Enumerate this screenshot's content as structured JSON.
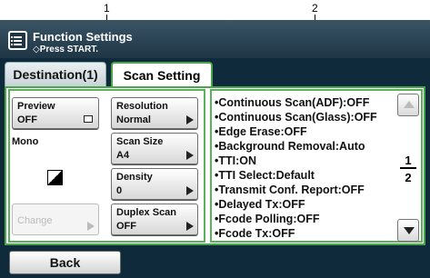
{
  "callouts": [
    "1",
    "2"
  ],
  "header": {
    "title": "Function Settings",
    "subtitle": "Press START."
  },
  "tabs": [
    {
      "label": "Destination(1)",
      "active": false
    },
    {
      "label": "Scan Setting",
      "active": true
    }
  ],
  "left_panel": {
    "preview": {
      "label": "Preview",
      "value": "OFF"
    },
    "mode_label": "Mono",
    "change_label": "Change"
  },
  "settings": [
    {
      "label": "Resolution",
      "value": "Normal"
    },
    {
      "label": "Scan Size",
      "value": "A4"
    },
    {
      "label": "Density",
      "value": "0"
    },
    {
      "label": "Duplex Scan",
      "value": "OFF"
    }
  ],
  "summary_list": [
    "•Continuous Scan(ADF):OFF",
    "•Continuous Scan(Glass):OFF",
    "•Edge Erase:OFF",
    "•Background Removal:Auto",
    "•TTI:ON",
    "•TTI Select:Default",
    "•Transmit Conf. Report:OFF",
    "•Delayed Tx:OFF",
    "•Fcode Polling:OFF",
    "•Fcode Tx:OFF"
  ],
  "pager": {
    "current": "1",
    "total": "2"
  },
  "footer": {
    "back_label": "Back"
  },
  "colors": {
    "accent_green": "#49a44a",
    "header_bg": "#1d3545"
  }
}
